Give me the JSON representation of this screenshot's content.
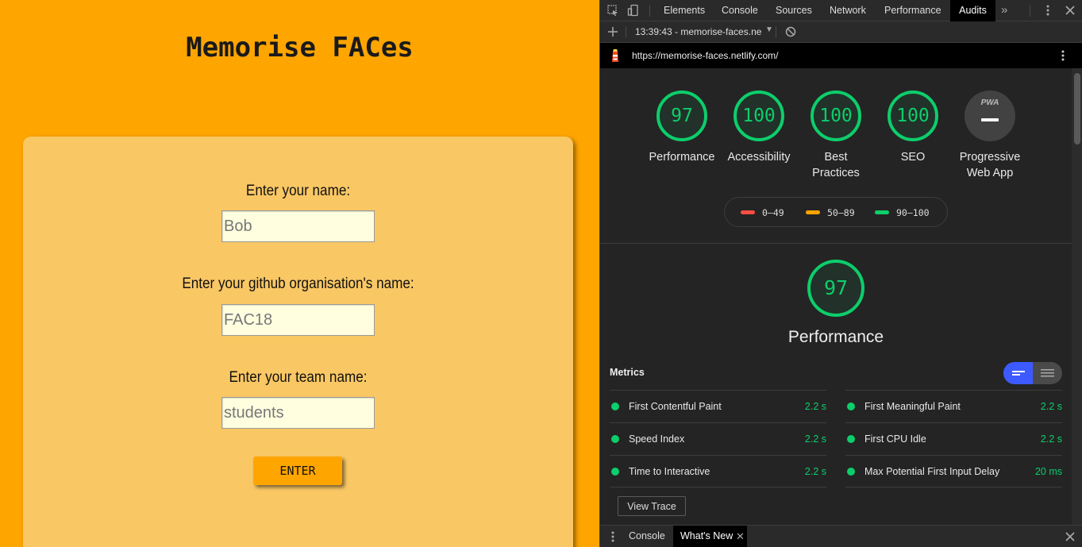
{
  "app": {
    "title": "Memorise FACes",
    "fields": [
      {
        "label": "Enter your name:",
        "placeholder": "Bob"
      },
      {
        "label": "Enter your github organisation's name:",
        "placeholder": "FAC18"
      },
      {
        "label": "Enter your team name:",
        "placeholder": "students"
      }
    ],
    "enter_label": "ENTER"
  },
  "devtools": {
    "tabs": [
      "Elements",
      "Console",
      "Sources",
      "Network",
      "Performance",
      "Audits"
    ],
    "active_tab": "Audits",
    "overflow_label": "»",
    "report_selector": "13:39:43 - memorise-faces.ne",
    "url": "https://memorise-faces.netlify.com/",
    "gauges": [
      {
        "value": "97",
        "label": "Performance"
      },
      {
        "value": "100",
        "label": "Accessibility"
      },
      {
        "value": "100",
        "label": "Best Practices",
        "label_line1": "Best",
        "label_line2": "Practices"
      },
      {
        "value": "100",
        "label": "SEO"
      }
    ],
    "pwa": {
      "badge": "PWA",
      "label_line1": "Progressive",
      "label_line2": "Web App"
    },
    "legend": [
      {
        "range": "0–49",
        "color": "#ff4e42"
      },
      {
        "range": "50–89",
        "color": "#ffa400"
      },
      {
        "range": "90–100",
        "color": "#0cce6b"
      }
    ],
    "performance": {
      "value": "97",
      "title": "Performance",
      "score_fraction": 0.97
    },
    "metrics_title": "Metrics",
    "metrics": [
      {
        "name": "First Contentful Paint",
        "value": "2.2 s"
      },
      {
        "name": "First Meaningful Paint",
        "value": "2.2 s"
      },
      {
        "name": "Speed Index",
        "value": "2.2 s"
      },
      {
        "name": "First CPU Idle",
        "value": "2.2 s"
      },
      {
        "name": "Time to Interactive",
        "value": "2.2 s"
      },
      {
        "name": "Max Potential First Input Delay",
        "value": "20 ms"
      }
    ],
    "view_trace_label": "View Trace",
    "drawer_tabs": [
      "Console",
      "What's New"
    ],
    "colors": {
      "pass": "#0cce6b",
      "accent": "#3d5afe"
    }
  }
}
